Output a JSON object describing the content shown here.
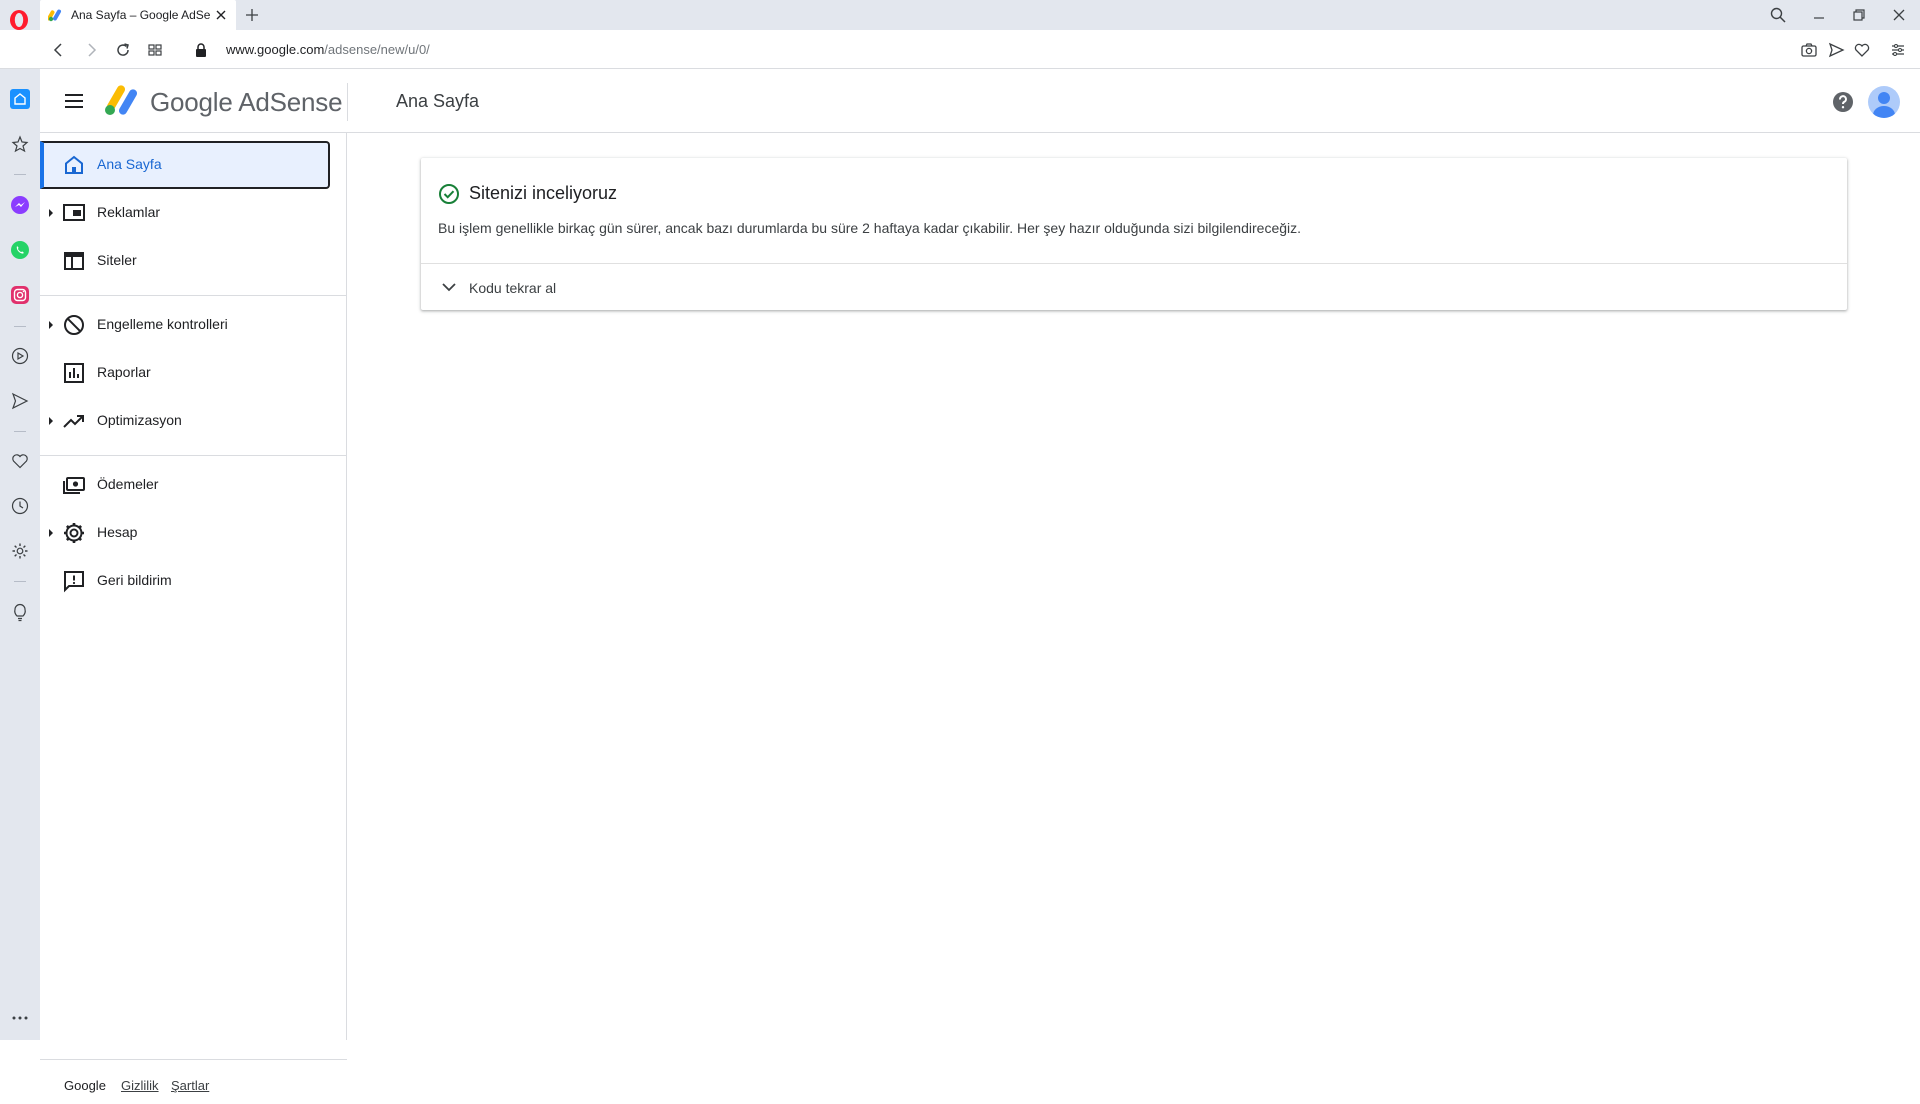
{
  "browser": {
    "tab_title": "Ana Sayfa – Google AdSense",
    "url_host": "www.google.com",
    "url_path": "/adsense/new/u/0/"
  },
  "app": {
    "brand": "Google AdSense",
    "page_title": "Ana Sayfa"
  },
  "nav": {
    "items": [
      {
        "label": "Ana Sayfa"
      },
      {
        "label": "Reklamlar"
      },
      {
        "label": "Siteler"
      },
      {
        "label": "Engelleme kontrolleri"
      },
      {
        "label": "Raporlar"
      },
      {
        "label": "Optimizasyon"
      },
      {
        "label": "Ödemeler"
      },
      {
        "label": "Hesap"
      },
      {
        "label": "Geri bildirim"
      }
    ],
    "footer": {
      "google": "Google",
      "privacy": "Gizlilik",
      "terms": "Şartlar"
    }
  },
  "card": {
    "title": "Sitenizi inceliyoruz",
    "description": "Bu işlem genellikle birkaç gün sürer, ancak bazı durumlarda bu süre 2 haftaya kadar çıkabilir. Her şey hazır olduğunda sizi bilgilendireceğiz.",
    "expander_label": "Kodu tekrar al"
  },
  "colors": {
    "accent": "#1a73e8",
    "active_bg": "#e8f0fe",
    "success": "#188038",
    "opera_red": "#ff1b2d"
  }
}
